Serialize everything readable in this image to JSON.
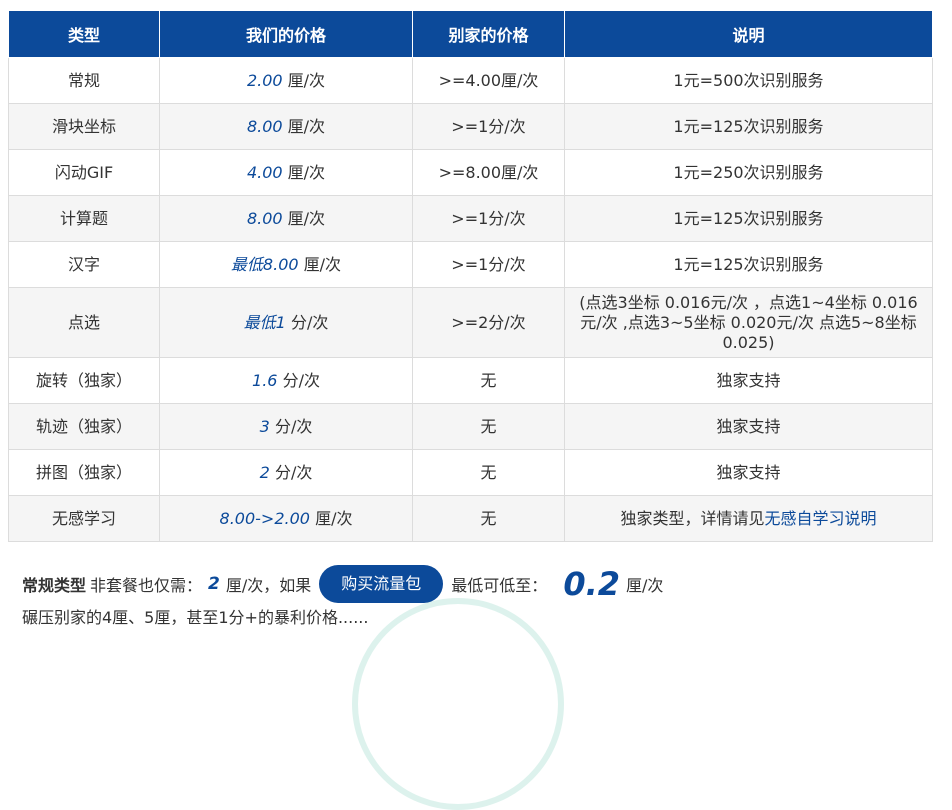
{
  "table": {
    "headers": [
      "类型",
      "我们的价格",
      "别家的价格",
      "说明"
    ],
    "rows": [
      {
        "type": "常规",
        "price_num": "2.00",
        "price_unit": "厘/次",
        "other": ">=4.00厘/次",
        "desc": "1元=500次识别服务"
      },
      {
        "type": "滑块坐标",
        "price_num": "8.00",
        "price_unit": "厘/次",
        "other": ">=1分/次",
        "desc": "1元=125次识别服务"
      },
      {
        "type": "闪动GIF",
        "price_num": "4.00",
        "price_unit": "厘/次",
        "other": ">=8.00厘/次",
        "desc": "1元=250次识别服务"
      },
      {
        "type": "计算题",
        "price_num": "8.00",
        "price_unit": "厘/次",
        "other": ">=1分/次",
        "desc": "1元=125次识别服务"
      },
      {
        "type": "汉字",
        "price_num": "最低8.00",
        "price_unit": "厘/次",
        "other": ">=1分/次",
        "desc": "1元=125次识别服务"
      },
      {
        "type": "点选",
        "price_num": "最低1",
        "price_unit": "分/次",
        "other": ">=2分/次",
        "desc": "(点选3坐标 0.016元/次 ，点选1~4坐标 0.016元/次 ,点选3~5坐标 0.020元/次 点选5~8坐标 0.025)"
      },
      {
        "type": "旋转（独家）",
        "price_num": "1.6",
        "price_unit": "分/次",
        "other": "无",
        "desc": "独家支持"
      },
      {
        "type": "轨迹（独家）",
        "price_num": "3",
        "price_unit": "分/次",
        "other": "无",
        "desc": "独家支持"
      },
      {
        "type": "拼图（独家）",
        "price_num": "2",
        "price_unit": "分/次",
        "other": "无",
        "desc": "独家支持"
      },
      {
        "type": "无感学习",
        "price_num": "8.00->2.00",
        "price_unit": "厘/次",
        "other": "无",
        "desc_prefix": "独家类型，详情请见",
        "desc_link": "无感自学习说明"
      }
    ]
  },
  "promo": {
    "label_bold": "常规类型",
    "text1": "非套餐也仅需：",
    "price": "2",
    "text2": "厘/次，如果",
    "button": "购买流量包",
    "text3": "最低可低至：",
    "min_price": "0.2",
    "unit": "厘/次",
    "line2": "碾压别家的4厘、5厘，甚至1分+的暴利价格......"
  },
  "colors": {
    "header_bg": "#0c4a9a",
    "accent": "#0c4a9a"
  }
}
